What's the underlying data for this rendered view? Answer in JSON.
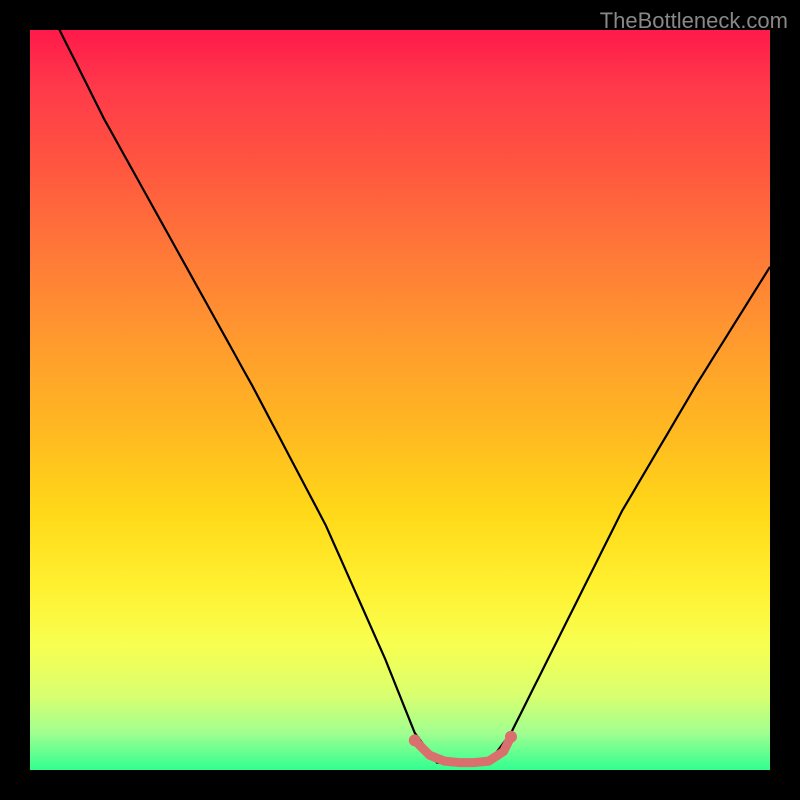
{
  "watermark": "TheBottleneck.com",
  "chart_data": {
    "type": "line",
    "title": "",
    "xlabel": "",
    "ylabel": "",
    "xlim": [
      0,
      100
    ],
    "ylim": [
      0,
      100
    ],
    "note": "No axis ticks or numeric labels are visible in the image; x and y units are unknown. Values below are normalized 0-100 estimates read from pixel positions (y=0 at bottom, y=100 at top).",
    "series": [
      {
        "name": "main-curve",
        "color": "#000000",
        "x": [
          0,
          4,
          10,
          20,
          30,
          40,
          48,
          52,
          55,
          58,
          62,
          65,
          70,
          80,
          90,
          100
        ],
        "y": [
          107,
          100,
          88,
          70,
          52,
          33,
          15,
          5,
          1,
          1,
          1,
          5,
          15,
          35,
          52,
          68
        ]
      },
      {
        "name": "highlight-segment",
        "color": "#d9706e",
        "x": [
          52,
          54,
          56,
          58,
          60,
          62,
          64,
          65
        ],
        "y": [
          4.0,
          2.0,
          1.2,
          1.0,
          1.0,
          1.2,
          2.5,
          4.5
        ]
      }
    ],
    "background_gradient": {
      "direction": "vertical",
      "stops": [
        {
          "pos": 0.0,
          "color": "#ff1a4a"
        },
        {
          "pos": 0.5,
          "color": "#ffca20"
        },
        {
          "pos": 0.8,
          "color": "#fff838"
        },
        {
          "pos": 1.0,
          "color": "#30ff90"
        }
      ]
    }
  }
}
